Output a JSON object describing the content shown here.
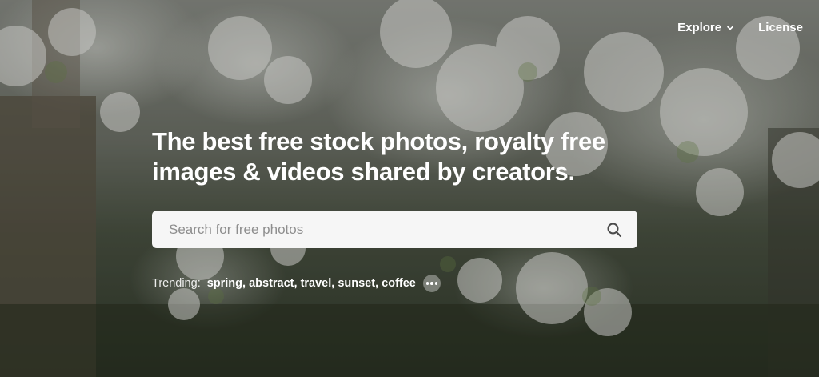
{
  "nav": {
    "explore_label": "Explore",
    "license_label": "License"
  },
  "hero": {
    "headline": "The best free stock photos, royalty free images & videos shared by creators."
  },
  "search": {
    "placeholder": "Search for free photos"
  },
  "trending": {
    "label": "Trending:",
    "items": [
      "spring",
      "abstract",
      "travel",
      "sunset",
      "coffee"
    ]
  },
  "icons": {
    "explore_chevron": "chevron-down-icon",
    "search": "search-icon",
    "more": "more-dots-icon"
  },
  "colors": {
    "text": "#ffffff",
    "search_bg": "#f6f6f6",
    "placeholder": "#8e8e8e"
  }
}
